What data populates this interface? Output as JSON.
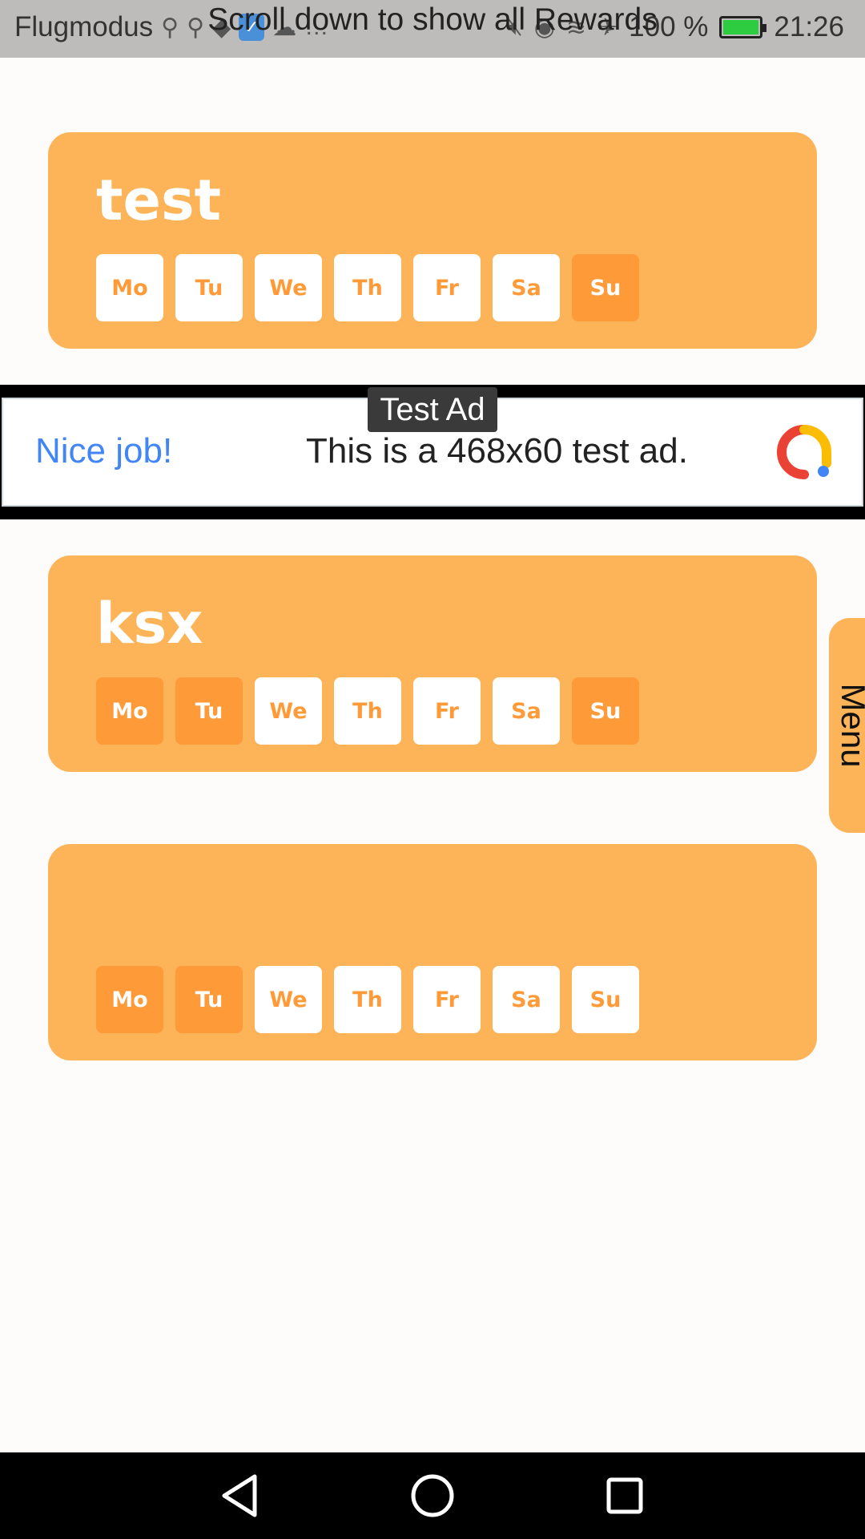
{
  "status_bar": {
    "carrier": "Flugmodus",
    "battery": "100 %",
    "time": "21:26"
  },
  "hint": "Scroll down to show all Rewards",
  "rewards": [
    {
      "title": "test",
      "days": [
        {
          "label": "Mo",
          "active": false
        },
        {
          "label": "Tu",
          "active": false
        },
        {
          "label": "We",
          "active": false
        },
        {
          "label": "Th",
          "active": false
        },
        {
          "label": "Fr",
          "active": false
        },
        {
          "label": "Sa",
          "active": false
        },
        {
          "label": "Su",
          "active": true
        }
      ]
    },
    {
      "title": "ksx",
      "days": [
        {
          "label": "Mo",
          "active": true
        },
        {
          "label": "Tu",
          "active": true
        },
        {
          "label": "We",
          "active": false
        },
        {
          "label": "Th",
          "active": false
        },
        {
          "label": "Fr",
          "active": false
        },
        {
          "label": "Sa",
          "active": false
        },
        {
          "label": "Su",
          "active": true
        }
      ]
    },
    {
      "title": "",
      "days": [
        {
          "label": "Mo",
          "active": true
        },
        {
          "label": "Tu",
          "active": true
        },
        {
          "label": "We",
          "active": false
        },
        {
          "label": "Th",
          "active": false
        },
        {
          "label": "Fr",
          "active": false
        },
        {
          "label": "Sa",
          "active": false
        },
        {
          "label": "Su",
          "active": false
        }
      ]
    }
  ],
  "ad": {
    "badge": "Test Ad",
    "headline": "Nice job!",
    "text": "This is a 468x60 test ad."
  },
  "menu": {
    "label": "Menu"
  },
  "colors": {
    "card": "#fdb459",
    "day_active": "#fe9a38",
    "day_inactive": "#ffffff",
    "background": "#fefcfa"
  },
  "nav_bar": {
    "buttons": [
      "back-icon",
      "home-icon",
      "recents-icon"
    ]
  }
}
